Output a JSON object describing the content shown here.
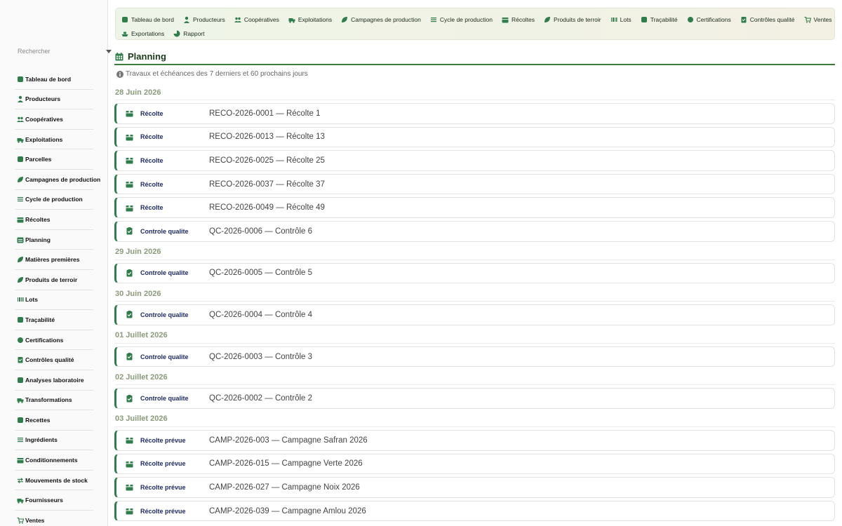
{
  "colors": {
    "accent": "#2f7d4a",
    "title": "#1a3a1a",
    "date": "#8a9a7a",
    "type": "#1f2a6a"
  },
  "search": {
    "placeholder": "Rechercher"
  },
  "sidebar": {
    "items": [
      {
        "label": "Tableau de bord",
        "icon": "dashboard-icon"
      },
      {
        "label": "Producteurs",
        "icon": "user-icon"
      },
      {
        "label": "Coopératives",
        "icon": "users-icon"
      },
      {
        "label": "Exploitations",
        "icon": "tractor-icon"
      },
      {
        "label": "Parcelles",
        "icon": "map-icon"
      },
      {
        "label": "Campagnes de production",
        "icon": "leaf-icon"
      },
      {
        "label": "Cycle de production",
        "icon": "list-icon"
      },
      {
        "label": "Récoltes",
        "icon": "box-icon"
      },
      {
        "label": "Planning",
        "icon": "calendar-icon"
      },
      {
        "label": "Matières premières",
        "icon": "seedling-icon"
      },
      {
        "label": "Produits de terroir",
        "icon": "sprout-icon"
      },
      {
        "label": "Lots",
        "icon": "barcode-icon"
      },
      {
        "label": "Traçabilité",
        "icon": "trace-icon"
      },
      {
        "label": "Certifications",
        "icon": "certificate-icon"
      },
      {
        "label": "Contrôles qualité",
        "icon": "clipboard-check-icon"
      },
      {
        "label": "Analyses laboratoire",
        "icon": "flask-icon"
      },
      {
        "label": "Transformations",
        "icon": "industry-icon"
      },
      {
        "label": "Recettes",
        "icon": "recipe-icon"
      },
      {
        "label": "Ingrédients",
        "icon": "list-ul-icon"
      },
      {
        "label": "Conditionnements",
        "icon": "package-icon"
      },
      {
        "label": "Mouvements de stock",
        "icon": "exchange-icon"
      },
      {
        "label": "Fournisseurs",
        "icon": "truck-icon"
      },
      {
        "label": "Ventes",
        "icon": "cart-icon"
      }
    ]
  },
  "topmenu": {
    "row1": [
      {
        "label": "Tableau de bord",
        "icon": "dashboard-icon"
      },
      {
        "label": "Producteurs",
        "icon": "user-icon"
      },
      {
        "label": "Coopératives",
        "icon": "users-icon"
      },
      {
        "label": "Exploitations",
        "icon": "tractor-icon"
      },
      {
        "label": "Campagnes de production",
        "icon": "leaf-icon"
      },
      {
        "label": "Cycle de production",
        "icon": "list-icon"
      },
      {
        "label": "Récoltes",
        "icon": "box-icon"
      },
      {
        "label": "Produits de terroir",
        "icon": "sprout-icon"
      },
      {
        "label": "Lots",
        "icon": "barcode-icon"
      },
      {
        "label": "Traçabilité",
        "icon": "trace-icon"
      },
      {
        "label": "Certifications",
        "icon": "certificate-icon"
      },
      {
        "label": "Contrôles qualité",
        "icon": "clipboard-check-icon"
      },
      {
        "label": "Ventes",
        "icon": "sales-icon"
      }
    ],
    "row2": [
      {
        "label": "Exportations",
        "icon": "ship-icon"
      },
      {
        "label": "Rapport",
        "icon": "chart-pie-icon"
      }
    ]
  },
  "header": {
    "title": "Planning"
  },
  "info": {
    "text": "Travaux et échéances des 7 derniers et 60 prochains jours"
  },
  "groups": [
    {
      "date": "28 Juin 2026",
      "events": [
        {
          "type": "Récolte",
          "title": "RECO-2026-0001 — Récolte 1",
          "kind": "box"
        },
        {
          "type": "Récolte",
          "title": "RECO-2026-0013 — Récolte 13",
          "kind": "box"
        },
        {
          "type": "Récolte",
          "title": "RECO-2026-0025 — Récolte 25",
          "kind": "box"
        },
        {
          "type": "Récolte",
          "title": "RECO-2026-0037 — Récolte 37",
          "kind": "box"
        },
        {
          "type": "Récolte",
          "title": "RECO-2026-0049 — Récolte 49",
          "kind": "box"
        },
        {
          "type": "Controle qualite",
          "title": "QC-2026-0006 — Contrôle 6",
          "kind": "check"
        }
      ]
    },
    {
      "date": "29 Juin 2026",
      "events": [
        {
          "type": "Controle qualite",
          "title": "QC-2026-0005 — Contrôle 5",
          "kind": "check"
        }
      ]
    },
    {
      "date": "30 Juin 2026",
      "events": [
        {
          "type": "Controle qualite",
          "title": "QC-2026-0004 — Contrôle 4",
          "kind": "check"
        }
      ]
    },
    {
      "date": "01 Juillet 2026",
      "events": [
        {
          "type": "Controle qualite",
          "title": "QC-2026-0003 — Contrôle 3",
          "kind": "check"
        }
      ]
    },
    {
      "date": "02 Juillet 2026",
      "events": [
        {
          "type": "Controle qualite",
          "title": "QC-2026-0002 — Contrôle 2",
          "kind": "check"
        }
      ]
    },
    {
      "date": "03 Juillet 2026",
      "events": [
        {
          "type": "Récolte prévue",
          "title": "CAMP-2026-003 — Campagne Safran 2026",
          "kind": "box"
        },
        {
          "type": "Récolte prévue",
          "title": "CAMP-2026-015 — Campagne Verte 2026",
          "kind": "box"
        },
        {
          "type": "Récolte prévue",
          "title": "CAMP-2026-027 — Campagne Noix 2026",
          "kind": "box"
        },
        {
          "type": "Récolte prévue",
          "title": "CAMP-2026-039 — Campagne Amlou 2026",
          "kind": "box"
        }
      ]
    }
  ]
}
